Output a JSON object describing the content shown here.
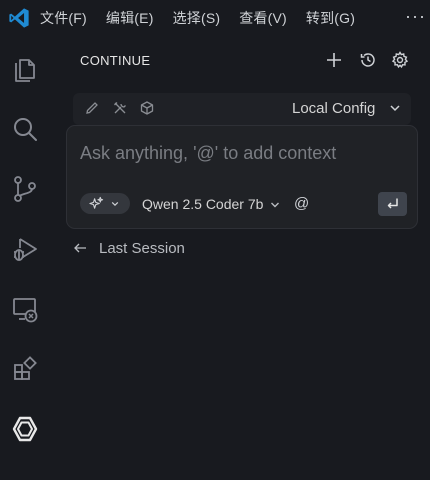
{
  "titlebar": {
    "menu": [
      "文件(F)",
      "编辑(E)",
      "选择(S)",
      "查看(V)",
      "转到(G)"
    ],
    "more": "···"
  },
  "activitybar": {
    "icons": [
      "explorer-icon",
      "search-icon",
      "source-control-icon",
      "run-debug-icon",
      "remote-explorer-icon",
      "extensions-icon",
      "continue-icon"
    ]
  },
  "panel": {
    "title": "CONTINUE",
    "header_icons": [
      "plus-icon",
      "history-icon",
      "gear-icon"
    ],
    "config": {
      "icons": [
        "pencil-icon",
        "tools-icon",
        "cube-icon"
      ],
      "selected": "Local Config"
    },
    "input": {
      "placeholder": "Ask anything, '@' to add context",
      "model": "Qwen 2.5 Coder 7b",
      "at_label": "@"
    },
    "last_session": "Last Session"
  },
  "colors": {
    "background": "#181a1f",
    "accent_blue": "#0078d4",
    "input_bg": "#202226"
  }
}
